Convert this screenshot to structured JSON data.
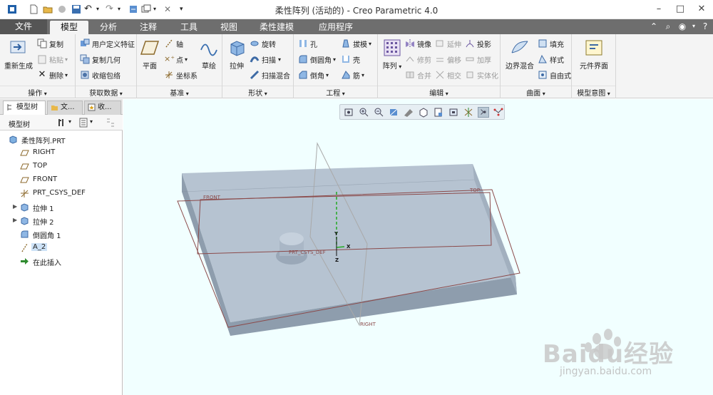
{
  "window": {
    "title": "柔性阵列 (活动的) - Creo Parametric 4.0"
  },
  "tabs": [
    {
      "label": "文件"
    },
    {
      "label": "模型"
    },
    {
      "label": "分析"
    },
    {
      "label": "注释"
    },
    {
      "label": "工具"
    },
    {
      "label": "视图"
    },
    {
      "label": "柔性建模"
    },
    {
      "label": "应用程序"
    }
  ],
  "ribbon": {
    "operations": {
      "label": "操作",
      "regenerate": "重新生成",
      "copy": "复制",
      "paste": "粘贴",
      "delete": "删除"
    },
    "get_data": {
      "label": "获取数据",
      "udf": "用户定义特征",
      "copy_geom": "复制几何",
      "shrinkwrap": "收缩包络"
    },
    "datum": {
      "label": "基准",
      "plane": "平面",
      "axis": "轴",
      "point": "点",
      "csys": "坐标系",
      "sketch": "草绘"
    },
    "shapes": {
      "label": "形状",
      "extrude": "拉伸",
      "revolve": "旋转",
      "sweep": "扫描",
      "swept_blend": "扫描混合"
    },
    "engineering": {
      "label": "工程",
      "hole": "孔",
      "round": "倒圆角",
      "chamfer": "倒角",
      "draft": "拔模",
      "shell": "壳",
      "rib": "筋"
    },
    "editing": {
      "label": "编辑",
      "pattern": "阵列",
      "mirror": "镜像",
      "trim": "修剪",
      "merge": "合并",
      "extend": "延伸",
      "offset": "偏移",
      "intersect": "相交",
      "project": "投影",
      "thicken": "加厚",
      "solidify": "实体化"
    },
    "surfaces": {
      "label": "曲面",
      "boundary_blend": "边界混合",
      "fill": "填充",
      "style": "样式",
      "freestyle": "自由式"
    },
    "model_intent": {
      "label": "模型意图",
      "component_interface": "元件界面"
    }
  },
  "panel": {
    "tabs": [
      {
        "label": "模型树"
      },
      {
        "label": "文..."
      },
      {
        "label": "收..."
      }
    ],
    "tree_label": "模型树"
  },
  "tree": [
    {
      "label": "柔性阵列.PRT",
      "icon": "part-icon"
    },
    {
      "label": "RIGHT",
      "icon": "datum-plane-icon"
    },
    {
      "label": "TOP",
      "icon": "datum-plane-icon"
    },
    {
      "label": "FRONT",
      "icon": "datum-plane-icon"
    },
    {
      "label": "PRT_CSYS_DEF",
      "icon": "csys-icon"
    },
    {
      "label": "拉伸 1",
      "icon": "extrude-icon"
    },
    {
      "label": "拉伸 2",
      "icon": "extrude-icon"
    },
    {
      "label": "倒圆角 1",
      "icon": "round-icon"
    },
    {
      "label": "A_2",
      "icon": "axis-icon"
    },
    {
      "label": "在此插入",
      "icon": "insert-arrow-icon"
    }
  ],
  "viewport": {
    "plane_labels": {
      "front": "FRONT",
      "top": "TOP",
      "right": "RIGHT"
    },
    "csys_label": "PRT_CSYS_DEF",
    "axis_labels": {
      "x": "X",
      "y": "Y",
      "z": "Z"
    }
  },
  "watermark": {
    "brand": "Baidu经验",
    "url": "jingyan.baidu.com"
  },
  "colors": {
    "tab_bar": "#6e6e6e",
    "viewport_bg": "#f1ffff",
    "part_top": "#b6c3d1",
    "part_side": "#8e9dad",
    "datum_plane": "#8b4a4a"
  }
}
